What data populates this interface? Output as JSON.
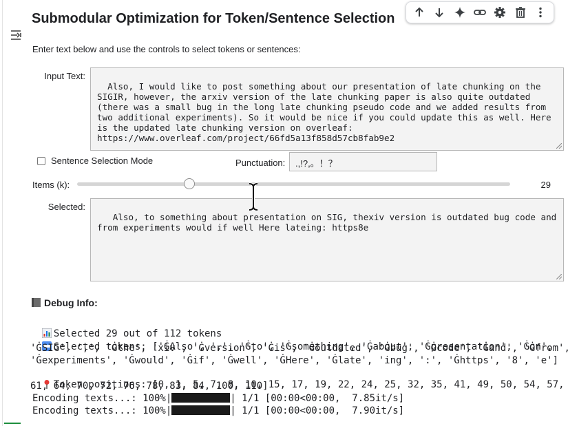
{
  "page": {
    "title": "Submodular Optimization for Token/Sentence Selection",
    "description": "Enter text below and use the controls to select tokens or sentences:"
  },
  "toolbar": {
    "icons": [
      "arrow-up-icon",
      "arrow-down-icon",
      "sparkle-icon",
      "link-icon",
      "gear-icon",
      "trash-icon",
      "more-vert-icon"
    ]
  },
  "form": {
    "input_label": "Input Text:",
    "input_text": "Also, I would like to post something about our presentation of late chunking on the SIGIR, however, the arxiv version of the late chunking paper is also quite outdated (there was a small bug in the long late chunking pseudo code and we added results from two additional experiments). So it would be nice if you could update this as well. Here is the updated late chunking version on overleaf:\nhttps://www.overleaf.com/project/66fd5a13f858d57cb8fab9e2",
    "sentence_mode_label": "Sentence Selection Mode",
    "sentence_mode_checked": false,
    "punctuation_label": "Punctuation:",
    "punctuation_value": ".,!?,。！？",
    "items_label": "Items (k):",
    "items_value": "29",
    "items_max": 112,
    "selected_label": "Selected:",
    "selected_text": " Also, to something about presentation on SIG, thexiv version is outdated bug code and from experiments would if well Here lateing: https8e"
  },
  "debug": {
    "heading": "Debug Info:",
    "lines": [
      {
        "icon": "bar-chart-icon",
        "text": "Selected 29 out of 112 tokens"
      },
      {
        "icon": "abc-icon",
        "text": "Selected tokens: ['ĠAlso', ',', 'Ġto', 'Ġsomething', 'Ġabout', 'Ġpresentation', 'Ġon',"
      },
      {
        "icon": "",
        "text": "'ĠSIG', ',', 'Ġthe', 'xiv', 'Ġversion', 'Ġis', 'Ġoutdated', 'Ġbug', 'Ġcode', 'Ġand', 'Ġfrom',"
      },
      {
        "icon": "",
        "text": "'Ġexperiments', 'Ġwould', 'Ġif', 'Ġwell', 'ĠHere', 'Ġlate', 'ing', ':', 'Ġhttps', '8', 'e']"
      },
      {
        "icon": "pin-icon",
        "text": "Token positions: [0, 1, 5, 7, 8, 10, 15, 17, 19, 22, 24, 25, 32, 35, 41, 49, 50, 54, 57,"
      },
      {
        "icon": "",
        "text": "61, 64, 70, 72, 76, 78, 83, 84, 100, 110]"
      }
    ],
    "progress": [
      {
        "prefix": "Encoding texts...: 100%|",
        "suffix": "| 1/1 [00:00<00:00,  7.85it/s]",
        "fraction": 1.0
      },
      {
        "prefix": "Encoding texts...: 100%|",
        "suffix": "| 1/1 [00:00<00:00,  7.90it/s]",
        "fraction": 1.0
      }
    ]
  }
}
